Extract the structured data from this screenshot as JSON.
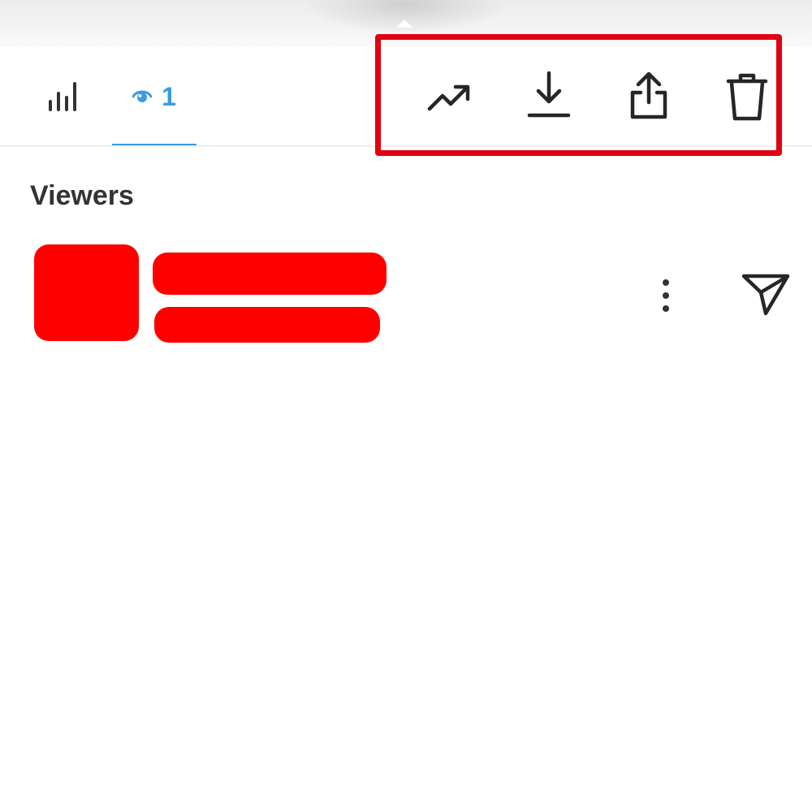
{
  "header": {
    "tabs": [
      {
        "name": "insights",
        "icon": "bar-chart-icon",
        "selected": false
      },
      {
        "name": "viewers",
        "icon": "eye-icon",
        "count": "1",
        "selected": true
      }
    ],
    "actions": [
      {
        "icon": "trending-up-icon"
      },
      {
        "icon": "download-icon"
      },
      {
        "icon": "share-icon"
      },
      {
        "icon": "trash-icon"
      }
    ],
    "highlight_color": "#e0000f",
    "accent_color": "#3a9be0"
  },
  "viewers_section": {
    "title": "Viewers",
    "viewers": [
      {
        "avatar": "redacted",
        "name": "redacted",
        "subtitle": "redacted",
        "redaction_color": "#ff0000"
      }
    ]
  }
}
